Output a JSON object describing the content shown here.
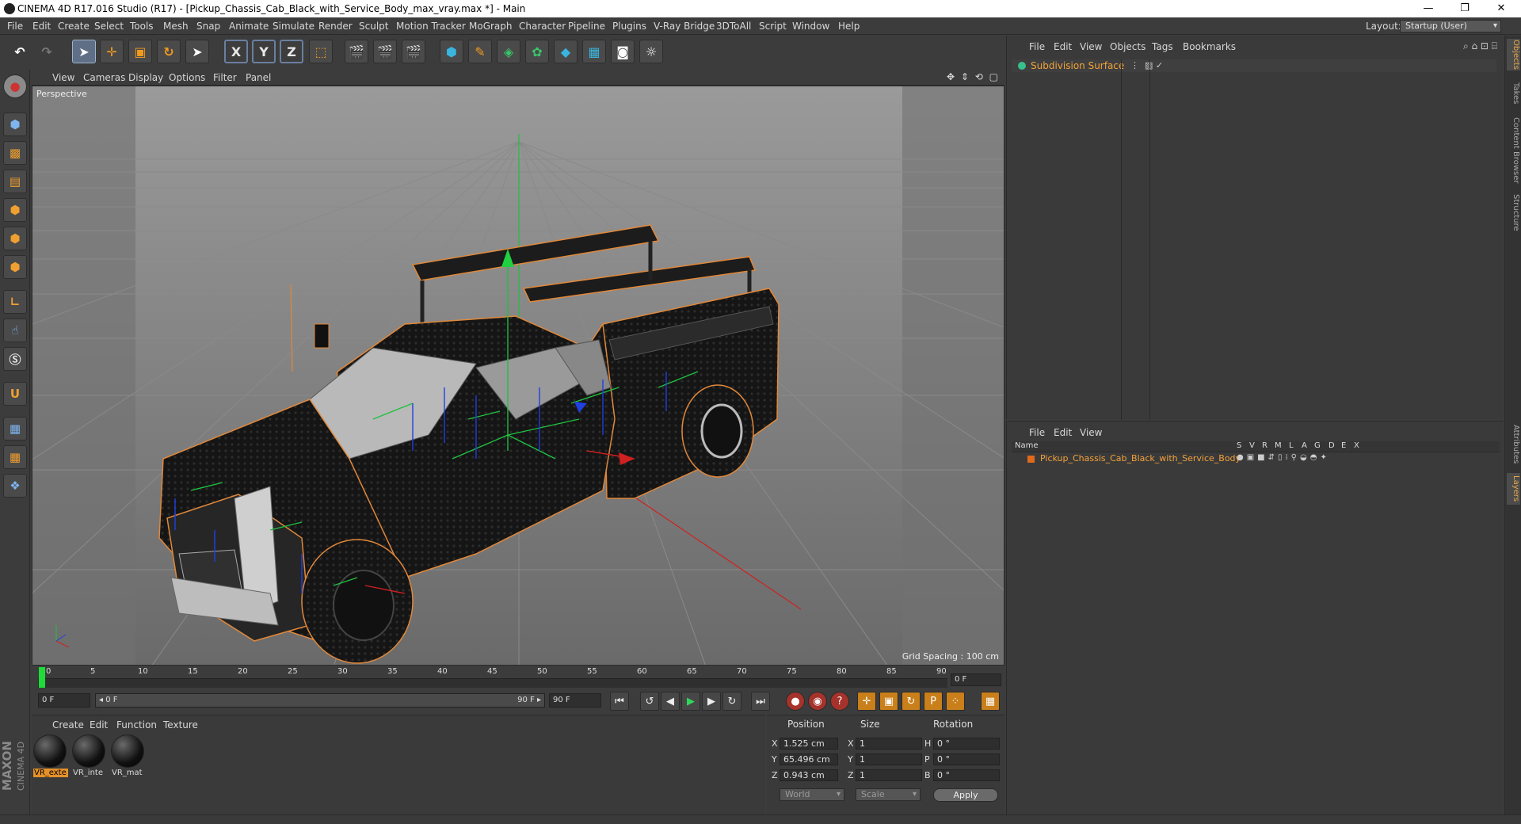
{
  "window": {
    "title": "CINEMA 4D R17.016 Studio (R17) - [Pickup_Chassis_Cab_Black_with_Service_Body_max_vray.max *] - Main",
    "minimize": "—",
    "restore": "❐",
    "close": "✕"
  },
  "menubar": {
    "items": [
      "File",
      "Edit",
      "Create",
      "Select",
      "Tools",
      "Mesh",
      "Snap",
      "Animate",
      "Simulate",
      "Render",
      "Sculpt",
      "Motion Tracker",
      "MoGraph",
      "Character",
      "Pipeline",
      "Plugins",
      "V-Ray Bridge",
      "3DToAll",
      "Script",
      "Window",
      "Help"
    ],
    "layout_label": "Layout:",
    "layout_value": "Startup (User)"
  },
  "toolbar": {
    "undo": "↶",
    "redo": "↷",
    "axis_x": "X",
    "axis_y": "Y",
    "axis_z": "Z",
    "icons": [
      "undo-icon",
      "redo-icon",
      "select-icon",
      "move-icon",
      "scale-icon",
      "rotate-icon",
      "live-select-icon",
      "x-axis-icon",
      "y-axis-icon",
      "z-axis-icon",
      "coordinate-system-icon",
      "render-view-icon",
      "render-picture-viewer-icon",
      "render-settings-icon",
      "cube-icon",
      "pen-spline-icon",
      "subdivision-icon",
      "array-icon",
      "deformer-icon",
      "floor-icon",
      "camera-icon",
      "light-icon"
    ]
  },
  "viewport": {
    "menu": [
      "View",
      "Cameras",
      "Display",
      "Options",
      "Filter",
      "Panel"
    ],
    "nav_icons": "✥ ⇕ ⟲ ▢",
    "camera_label": "Perspective",
    "grid_spacing": "Grid Spacing : 100 cm"
  },
  "timeline": {
    "ticks": [
      "0",
      "5",
      "10",
      "15",
      "20",
      "25",
      "30",
      "35",
      "40",
      "45",
      "50",
      "55",
      "60",
      "65",
      "70",
      "75",
      "80",
      "85",
      "90"
    ],
    "current_frame": "0 F"
  },
  "playback": {
    "start_field": "0 F",
    "range_start": "◂ 0 F",
    "range_end": "90 F ▸",
    "end_field": "90 F"
  },
  "material_manager": {
    "menu": [
      "Create",
      "Edit",
      "Function",
      "Texture"
    ],
    "materials": [
      {
        "label": "VR_exte",
        "selected": true
      },
      {
        "label": "VR_inte",
        "selected": false
      },
      {
        "label": "VR_mat",
        "selected": false
      }
    ],
    "logo_line1": "MAXON",
    "logo_line2": "CINEMA 4D"
  },
  "coordinates": {
    "headers": [
      "Position",
      "Size",
      "Rotation"
    ],
    "rows": [
      {
        "axis": "X",
        "pos": "1.525 cm",
        "size_axis": "X",
        "size": "1",
        "rot_axis": "H",
        "rot": "0 °"
      },
      {
        "axis": "Y",
        "pos": "65.496 cm",
        "size_axis": "Y",
        "size": "1",
        "rot_axis": "P",
        "rot": "0 °"
      },
      {
        "axis": "Z",
        "pos": "0.943 cm",
        "size_axis": "Z",
        "size": "1",
        "rot_axis": "B",
        "rot": "0 °"
      }
    ],
    "space_select": "World",
    "mode_select": "Scale",
    "apply": "Apply"
  },
  "object_manager": {
    "menu": [
      "File",
      "Edit",
      "View",
      "Objects",
      "Tags",
      "Bookmarks"
    ],
    "object_name": "Subdivision Surface"
  },
  "layer_manager": {
    "menu": [
      "File",
      "Edit",
      "View"
    ],
    "headers": [
      "Name",
      "S",
      "V",
      "R",
      "M",
      "L",
      "A",
      "G",
      "D",
      "E",
      "X"
    ],
    "layer_name": "Pickup_Chassis_Cab_Black_with_Service_Body"
  },
  "right_tabs": [
    "Objects",
    "Takes",
    "Content Browser",
    "Structure",
    "Attributes",
    "Layers"
  ],
  "colors": {
    "accent": "#f2a23a",
    "background": "#3c3c3c",
    "viewport": "#7a7a7a",
    "x_axis": "#e02020",
    "y_axis": "#20d040",
    "z_axis": "#2040e0"
  }
}
